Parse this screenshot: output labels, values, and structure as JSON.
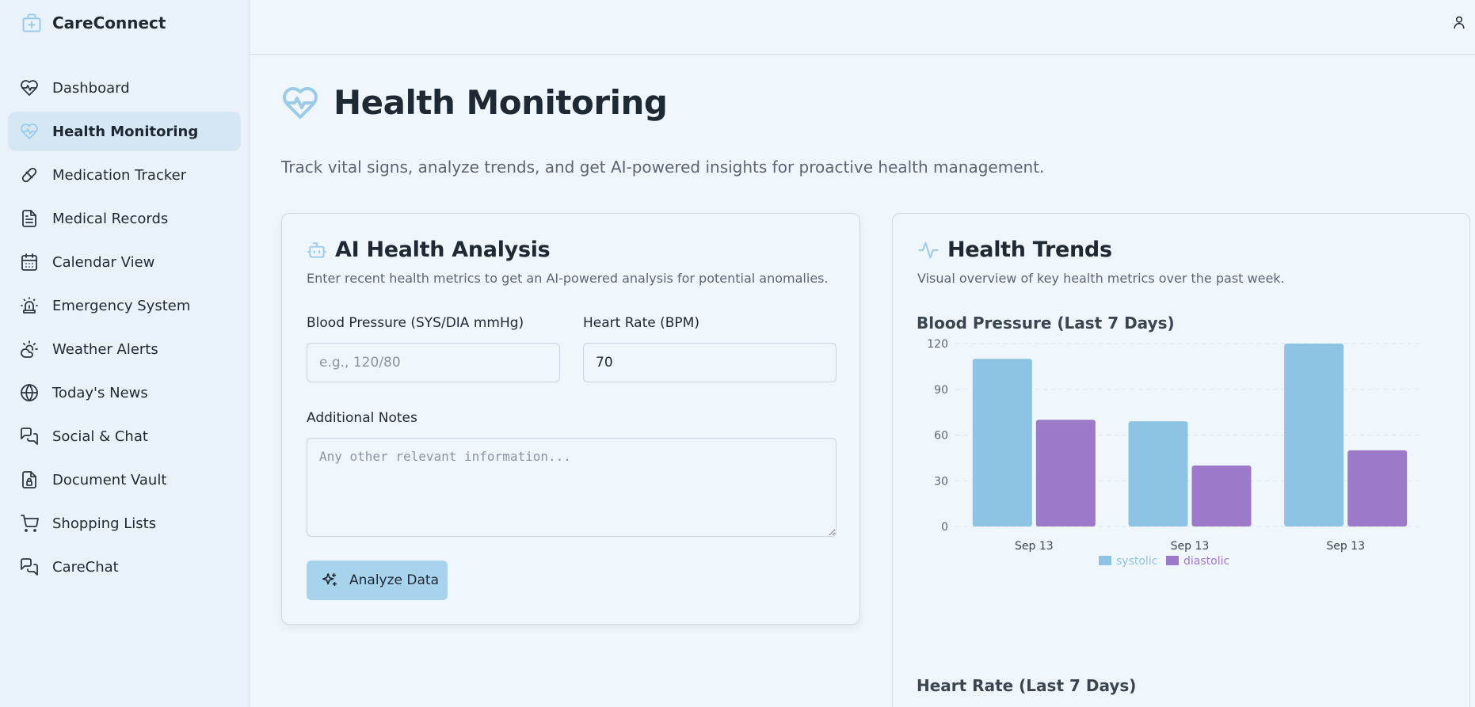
{
  "app": {
    "name": "CareConnect"
  },
  "sidebar": {
    "items": [
      {
        "label": "Dashboard",
        "icon": "heart-pulse-icon",
        "active": false
      },
      {
        "label": "Health Monitoring",
        "icon": "heart-pulse-icon",
        "active": true
      },
      {
        "label": "Medication Tracker",
        "icon": "pill-icon",
        "active": false
      },
      {
        "label": "Medical Records",
        "icon": "file-text-icon",
        "active": false
      },
      {
        "label": "Calendar View",
        "icon": "calendar-icon",
        "active": false
      },
      {
        "label": "Emergency System",
        "icon": "siren-icon",
        "active": false
      },
      {
        "label": "Weather Alerts",
        "icon": "cloud-sun-icon",
        "active": false
      },
      {
        "label": "Today's News",
        "icon": "globe-icon",
        "active": false
      },
      {
        "label": "Social & Chat",
        "icon": "messages-icon",
        "active": false
      },
      {
        "label": "Document Vault",
        "icon": "file-lock-icon",
        "active": false
      },
      {
        "label": "Shopping Lists",
        "icon": "cart-icon",
        "active": false
      },
      {
        "label": "CareChat",
        "icon": "messages-icon",
        "active": false
      }
    ]
  },
  "page": {
    "title": "Health Monitoring",
    "description": "Track vital signs, analyze trends, and get AI-powered insights for proactive health management."
  },
  "ai_card": {
    "title": "AI Health Analysis",
    "subtitle": "Enter recent health metrics to get an AI-powered analysis for potential anomalies.",
    "bp_label": "Blood Pressure (SYS/DIA mmHg)",
    "bp_placeholder": "e.g., 120/80",
    "bp_value": "",
    "hr_label": "Heart Rate (BPM)",
    "hr_value": "70",
    "notes_label": "Additional Notes",
    "notes_placeholder": "Any other relevant information...",
    "analyze_label": "Analyze Data"
  },
  "trends_card": {
    "title": "Health Trends",
    "subtitle": "Visual overview of key health metrics over the past week.",
    "bp_chart_title": "Blood Pressure (Last 7 Days)",
    "hr_chart_title": "Heart Rate (Last 7 Days)"
  },
  "colors": {
    "accent": "#9ccbe8",
    "systolic": "#8ec4e3",
    "diastolic": "#9c79c9",
    "active_nav": "#d6e7f4"
  },
  "chart_data": {
    "type": "bar",
    "title": "Blood Pressure (Last 7 Days)",
    "categories": [
      "Sep 13",
      "Sep 13",
      "Sep 13"
    ],
    "series": [
      {
        "name": "systolic",
        "values": [
          110,
          69,
          120
        ]
      },
      {
        "name": "diastolic",
        "values": [
          70,
          40,
          50
        ]
      }
    ],
    "yticks": [
      0,
      30,
      60,
      90,
      120
    ],
    "ylim": [
      0,
      120
    ],
    "grid": true,
    "legend": "bottom"
  }
}
